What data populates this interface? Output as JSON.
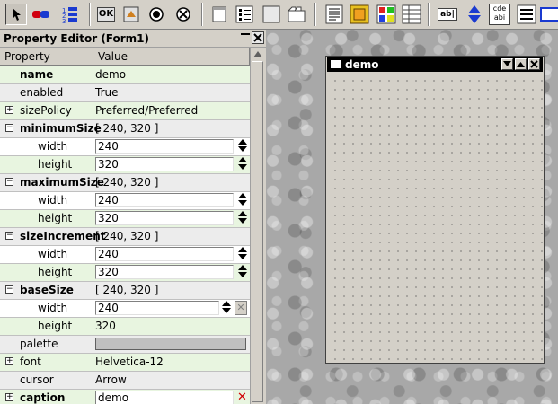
{
  "toolbar": {
    "ok_label": "OK",
    "abl_label": "ab|",
    "cde_label": "cde",
    "abi_label": "abi"
  },
  "property_editor": {
    "title": "Property Editor (Form1)",
    "column_property": "Property",
    "column_value": "Value",
    "rows": {
      "name": {
        "label": "name",
        "value": "demo"
      },
      "enabled": {
        "label": "enabled",
        "value": "True"
      },
      "sizePolicy": {
        "label": "sizePolicy",
        "value": "Preferred/Preferred"
      },
      "minimumSize": {
        "label": "minimumSize",
        "value": "[ 240, 320 ]",
        "width_label": "width",
        "width": "240",
        "height_label": "height",
        "height": "320"
      },
      "maximumSize": {
        "label": "maximumSize",
        "value": "[ 240, 320 ]",
        "width_label": "width",
        "width": "240",
        "height_label": "height",
        "height": "320"
      },
      "sizeIncrement": {
        "label": "sizeIncrement",
        "value": "[ 240, 320 ]",
        "width_label": "width",
        "width": "240",
        "height_label": "height",
        "height": "320"
      },
      "baseSize": {
        "label": "baseSize",
        "value": "[ 240, 320 ]",
        "width_label": "width",
        "width": "240",
        "height_label": "height",
        "height": "320"
      },
      "palette": {
        "label": "palette"
      },
      "font": {
        "label": "font",
        "value": "Helvetica-12"
      },
      "cursor": {
        "label": "cursor",
        "value": "Arrow"
      },
      "caption": {
        "label": "caption",
        "value": "demo"
      }
    }
  },
  "form_window": {
    "title": "demo"
  },
  "colors": {
    "titlebar": "#000000",
    "row_highlight": "#e8f5e0",
    "caption_clear": "#d00000"
  }
}
